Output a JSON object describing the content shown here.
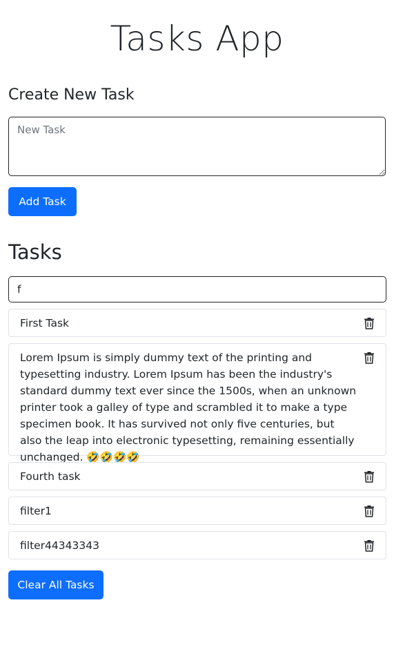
{
  "app": {
    "title": "Tasks App"
  },
  "create": {
    "title": "Create New Task",
    "placeholder": "New Task",
    "value": "",
    "add_button_label": "Add Task"
  },
  "tasks": {
    "title": "Tasks",
    "filter_value": "f",
    "items": [
      {
        "text": "First Task",
        "icon": "trash-icon"
      },
      {
        "text": "Lorem Ipsum is simply dummy text of the printing and typesetting industry. Lorem Ipsum has been the industry's standard dummy text ever since the 1500s, when an unknown printer took a galley of type and scrambled it to make a type specimen book. It has survived not only five centuries, but also the leap into electronic typesetting, remaining essentially unchanged. 🤣🤣🤣🤣",
        "icon": "trash-icon"
      },
      {
        "text": "Fourth task",
        "icon": "trash-icon"
      },
      {
        "text": "filter1",
        "icon": "trash-icon"
      },
      {
        "text": "filter44343343",
        "icon": "trash-icon"
      }
    ],
    "clear_button_label": "Clear All Tasks"
  },
  "colors": {
    "primary": "#0d6efd",
    "text": "#212529",
    "border": "#dee2e6",
    "placeholder": "#6c757d"
  }
}
